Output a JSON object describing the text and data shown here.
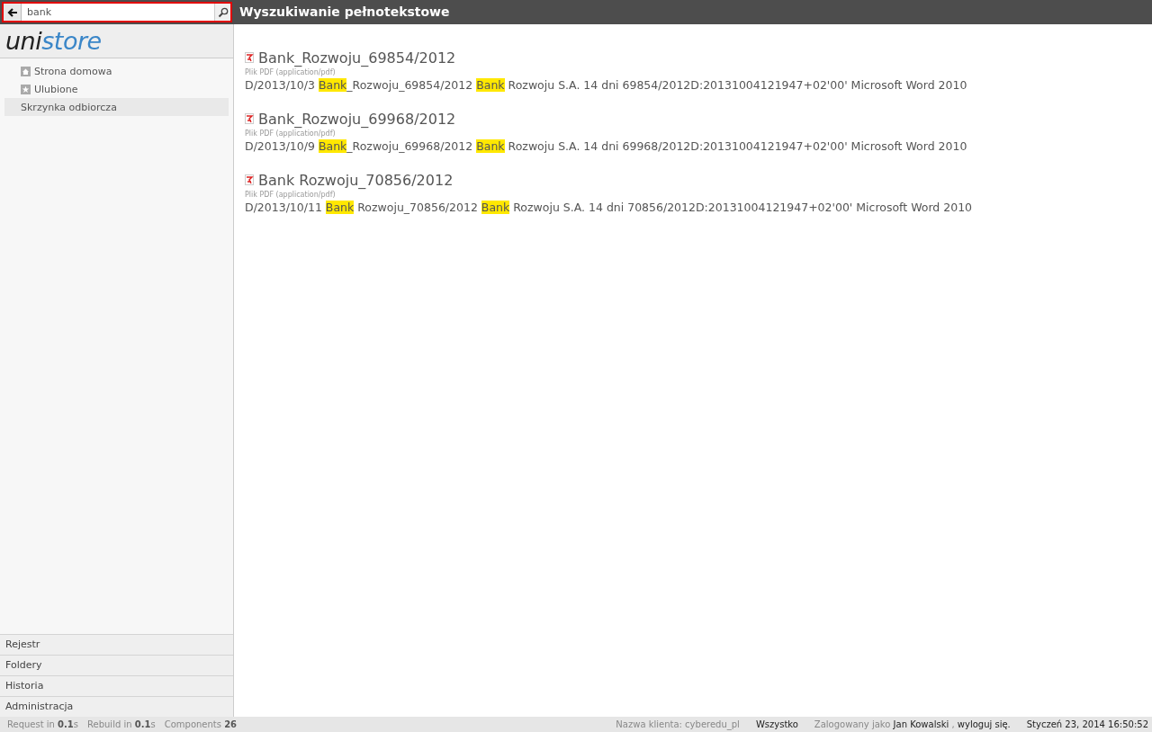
{
  "search": {
    "value": "bank"
  },
  "header": {
    "title": "Wyszukiwanie pełnotekstowe"
  },
  "logo": {
    "prefix": "uni",
    "suffix": "store"
  },
  "sidebar": {
    "items": [
      {
        "label": "Strona domowa",
        "kind": "home",
        "selected": false
      },
      {
        "label": "Ulubione",
        "kind": "star",
        "selected": false
      },
      {
        "label": "Skrzynka odbiorcza",
        "kind": "plain",
        "selected": true
      }
    ],
    "sections": [
      "Rejestr",
      "Foldery",
      "Historia",
      "Administracja"
    ]
  },
  "results": [
    {
      "title": "Bank_Rozwoju_69854/2012",
      "type": "Plik PDF (application/pdf)",
      "snippet": [
        {
          "text": "D/2013/10/3 ",
          "highlight": false
        },
        {
          "text": "Bank",
          "highlight": true
        },
        {
          "text": "_Rozwoju_69854/2012 ",
          "highlight": false
        },
        {
          "text": "Bank",
          "highlight": true
        },
        {
          "text": " Rozwoju S.A. 14 dni 69854/2012D:20131004121947+02'00' Microsoft Word 2010",
          "highlight": false
        }
      ]
    },
    {
      "title": "Bank_Rozwoju_69968/2012",
      "type": "Plik PDF (application/pdf)",
      "snippet": [
        {
          "text": "D/2013/10/9 ",
          "highlight": false
        },
        {
          "text": "Bank",
          "highlight": true
        },
        {
          "text": "_Rozwoju_69968/2012 ",
          "highlight": false
        },
        {
          "text": "Bank",
          "highlight": true
        },
        {
          "text": " Rozwoju S.A. 14 dni 69968/2012D:20131004121947+02'00' Microsoft Word 2010",
          "highlight": false
        }
      ]
    },
    {
      "title": "Bank Rozwoju_70856/2012",
      "type": "Plik PDF (application/pdf)",
      "snippet": [
        {
          "text": "D/2013/10/11 ",
          "highlight": false
        },
        {
          "text": "Bank",
          "highlight": true
        },
        {
          "text": " Rozwoju_70856/2012 ",
          "highlight": false
        },
        {
          "text": "Bank",
          "highlight": true
        },
        {
          "text": " Rozwoju S.A. 14 dni 70856/2012D:20131004121947+02'00' Microsoft Word 2010",
          "highlight": false
        }
      ]
    }
  ],
  "status_bar": {
    "stats": [
      "Request in **0.1**s",
      "Rebuild in **0.1**s",
      "Components **26**"
    ],
    "client": "Nazwa klienta: cyberedu_pl",
    "filter": "Wszystko",
    "logged_prefix": "Zalogowany jako",
    "user": "Jan Kowalski",
    "separator": ",",
    "logout": "wyloguj się.",
    "datetime": "Styczeń 23, 2014 16:50:52"
  }
}
